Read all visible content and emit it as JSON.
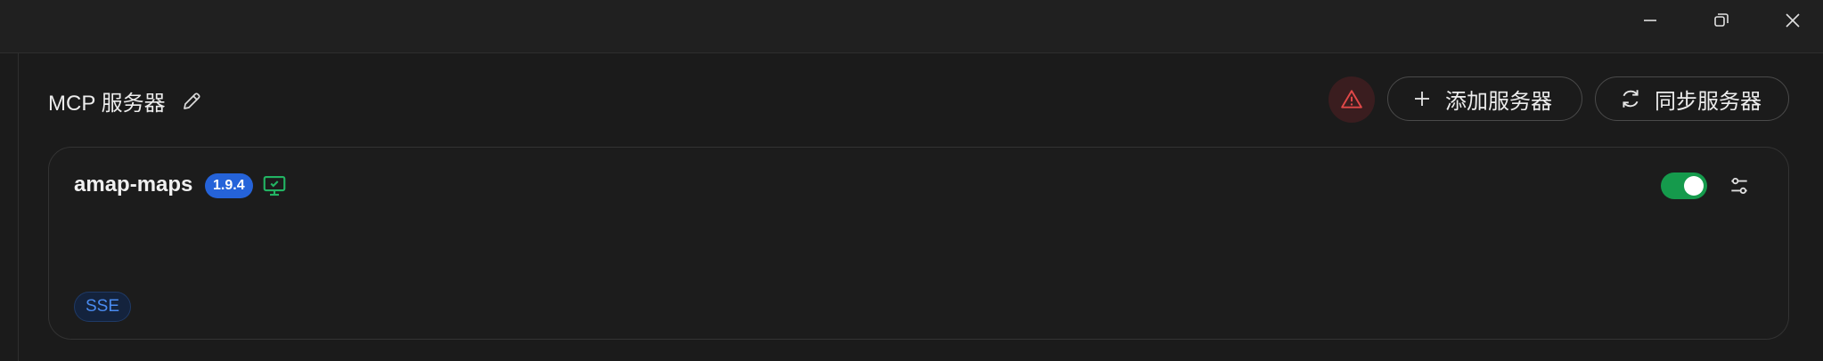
{
  "window": {
    "controls": [
      {
        "name": "minimize",
        "icon": "minimize-icon"
      },
      {
        "name": "restore",
        "icon": "restore-icon"
      },
      {
        "name": "close",
        "icon": "close-icon"
      }
    ]
  },
  "header": {
    "title": "MCP 服务器",
    "edit_icon": "pencil-icon",
    "warning_icon": "warning-icon",
    "add_button_label": "添加服务器",
    "sync_button_label": "同步服务器"
  },
  "servers": [
    {
      "name": "amap-maps",
      "version": "1.9.4",
      "status_icon": "monitor-check-icon",
      "transport": "SSE",
      "enabled": true
    }
  ],
  "colors": {
    "background": "#1b1b1b",
    "accent_blue": "#2563d9",
    "toggle_green": "#159a4c",
    "warning_red": "#e04848",
    "status_green": "#22b463"
  }
}
